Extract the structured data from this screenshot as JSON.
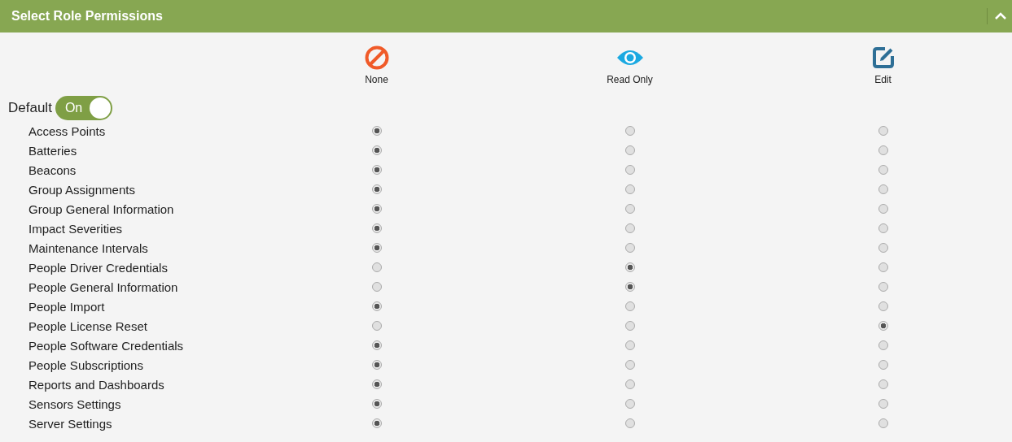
{
  "panel": {
    "title": "Select Role Permissions",
    "expanded": true
  },
  "columns": [
    {
      "kind": "none",
      "label": "None"
    },
    {
      "kind": "read",
      "label": "Read Only"
    },
    {
      "kind": "edit",
      "label": "Edit"
    }
  ],
  "default": {
    "label": "Default",
    "toggle_text": "On",
    "on": true
  },
  "rows": [
    {
      "name": "Access Points",
      "options": [
        {
          "selected": true
        },
        {
          "selected": false
        },
        {
          "selected": false
        }
      ]
    },
    {
      "name": "Batteries",
      "options": [
        {
          "selected": true
        },
        {
          "selected": false
        },
        {
          "selected": false
        }
      ]
    },
    {
      "name": "Beacons",
      "options": [
        {
          "selected": true
        },
        {
          "selected": false
        },
        {
          "selected": false
        }
      ]
    },
    {
      "name": "Group Assignments",
      "options": [
        {
          "selected": true
        },
        {
          "selected": false
        },
        {
          "selected": false
        }
      ]
    },
    {
      "name": "Group General Information",
      "options": [
        {
          "selected": true
        },
        {
          "selected": false
        },
        {
          "selected": false
        }
      ]
    },
    {
      "name": "Impact Severities",
      "options": [
        {
          "selected": true
        },
        {
          "selected": false
        },
        {
          "selected": false
        }
      ]
    },
    {
      "name": "Maintenance Intervals",
      "options": [
        {
          "selected": true
        },
        {
          "selected": false
        },
        {
          "selected": false
        }
      ]
    },
    {
      "name": "People Driver Credentials",
      "options": [
        {
          "selected": false
        },
        {
          "selected": true
        },
        {
          "selected": false
        }
      ]
    },
    {
      "name": "People General Information",
      "options": [
        {
          "selected": false
        },
        {
          "selected": true
        },
        {
          "selected": false
        }
      ]
    },
    {
      "name": "People Import",
      "options": [
        {
          "selected": true
        },
        {
          "selected": false
        },
        {
          "selected": false
        }
      ]
    },
    {
      "name": "People License Reset",
      "options": [
        {
          "selected": false
        },
        {
          "selected": false
        },
        {
          "selected": true
        }
      ]
    },
    {
      "name": "People Software Credentials",
      "options": [
        {
          "selected": true
        },
        {
          "selected": false
        },
        {
          "selected": false
        }
      ]
    },
    {
      "name": "People Subscriptions",
      "options": [
        {
          "selected": true
        },
        {
          "selected": false
        },
        {
          "selected": false
        }
      ]
    },
    {
      "name": "Reports and Dashboards",
      "options": [
        {
          "selected": true
        },
        {
          "selected": false
        },
        {
          "selected": false
        }
      ]
    },
    {
      "name": "Sensors Settings",
      "options": [
        {
          "selected": true
        },
        {
          "selected": false
        },
        {
          "selected": false
        }
      ]
    },
    {
      "name": "Server Settings",
      "options": [
        {
          "selected": true
        },
        {
          "selected": false
        },
        {
          "selected": false
        }
      ]
    }
  ]
}
